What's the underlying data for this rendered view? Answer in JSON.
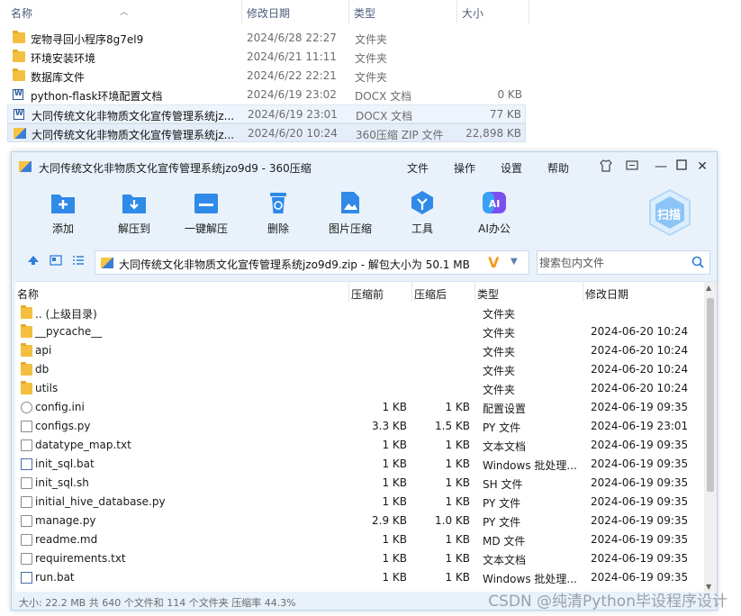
{
  "explorer": {
    "headers": {
      "name": "名称",
      "date": "修改日期",
      "type": "类型",
      "size": "大小"
    },
    "rows": [
      {
        "name": "宠物寻回小程序8g7el9",
        "date": "2024/6/28 22:27",
        "type": "文件夹",
        "size": "",
        "icon": "folder-icon"
      },
      {
        "name": "环境安装环境",
        "date": "2024/6/21 11:11",
        "type": "文件夹",
        "size": "",
        "icon": "folder-icon"
      },
      {
        "name": "数据库文件",
        "date": "2024/6/22 22:21",
        "type": "文件夹",
        "size": "",
        "icon": "folder-icon"
      },
      {
        "name": "python-flask环境配置文档",
        "date": "2024/6/19 23:02",
        "type": "DOCX 文档",
        "size": "0 KB",
        "icon": "docx-icon"
      },
      {
        "name": "大同传统文化非物质文化宣传管理系统jz...",
        "date": "2024/6/19 23:01",
        "type": "DOCX 文档",
        "size": "77 KB",
        "icon": "docx-icon"
      },
      {
        "name": "大同传统文化非物质文化宣传管理系统jz...",
        "date": "2024/6/20 10:24",
        "type": "360压缩 ZIP 文件",
        "size": "22,898 KB",
        "icon": "zip-icon"
      }
    ]
  },
  "window": {
    "title": "大同传统文化非物质文化宣传管理系统jzo9d9 - 360压缩",
    "menu": [
      "文件",
      "操作",
      "设置",
      "帮助"
    ],
    "toolbar": [
      "添加",
      "解压到",
      "一键解压",
      "删除",
      "图片压缩",
      "工具",
      "AI办公"
    ],
    "scan_label": "扫描",
    "path": "大同传统文化非物质文化宣传管理系统jzo9d9.zip - 解包大小为 50.1 MB",
    "search_placeholder": "搜索包内文件",
    "columns": {
      "name": "名称",
      "before": "压缩前",
      "after": "压缩后",
      "type": "类型",
      "date": "修改日期"
    },
    "files": [
      {
        "name": ".. (上级目录)",
        "before": "",
        "after": "",
        "type": "文件夹",
        "date": "",
        "icon": "folder-icon"
      },
      {
        "name": "__pycache__",
        "before": "",
        "after": "",
        "type": "文件夹",
        "date": "2024-06-20 10:24",
        "icon": "folder-icon"
      },
      {
        "name": "api",
        "before": "",
        "after": "",
        "type": "文件夹",
        "date": "2024-06-20 10:24",
        "icon": "folder-icon"
      },
      {
        "name": "db",
        "before": "",
        "after": "",
        "type": "文件夹",
        "date": "2024-06-20 10:24",
        "icon": "folder-icon"
      },
      {
        "name": "utils",
        "before": "",
        "after": "",
        "type": "文件夹",
        "date": "2024-06-20 10:24",
        "icon": "folder-icon"
      },
      {
        "name": "config.ini",
        "before": "1 KB",
        "after": "1 KB",
        "type": "配置设置",
        "date": "2024-06-19 09:35",
        "icon": "gear-file-icon"
      },
      {
        "name": "configs.py",
        "before": "3.3 KB",
        "after": "1.5 KB",
        "type": "PY 文件",
        "date": "2024-06-19 23:01",
        "icon": "file-icon"
      },
      {
        "name": "datatype_map.txt",
        "before": "1 KB",
        "after": "1 KB",
        "type": "文本文档",
        "date": "2024-06-19 09:35",
        "icon": "file-icon"
      },
      {
        "name": "init_sql.bat",
        "before": "1 KB",
        "after": "1 KB",
        "type": "Windows 批处理...",
        "date": "2024-06-19 09:35",
        "icon": "bat-icon"
      },
      {
        "name": "init_sql.sh",
        "before": "1 KB",
        "after": "1 KB",
        "type": "SH 文件",
        "date": "2024-06-19 09:35",
        "icon": "file-icon"
      },
      {
        "name": "initial_hive_database.py",
        "before": "1 KB",
        "after": "1 KB",
        "type": "PY 文件",
        "date": "2024-06-19 09:35",
        "icon": "file-icon"
      },
      {
        "name": "manage.py",
        "before": "2.9 KB",
        "after": "1.0 KB",
        "type": "PY 文件",
        "date": "2024-06-19 09:35",
        "icon": "file-icon"
      },
      {
        "name": "readme.md",
        "before": "1 KB",
        "after": "1 KB",
        "type": "MD 文件",
        "date": "2024-06-19 09:35",
        "icon": "file-icon"
      },
      {
        "name": "requirements.txt",
        "before": "1 KB",
        "after": "1 KB",
        "type": "文本文档",
        "date": "2024-06-19 09:35",
        "icon": "file-icon"
      },
      {
        "name": "run.bat",
        "before": "1 KB",
        "after": "1 KB",
        "type": "Windows 批处理...",
        "date": "2024-06-19 09:35",
        "icon": "bat-icon"
      }
    ],
    "status": "大小: 22.2 MB 共 640 个文件和 114 个文件夹 压缩率 44.3%"
  },
  "watermark": "CSDN @纯清Python毕设程序设计",
  "colors": {
    "accent": "#2f8ae8",
    "window_bg": "#e9f2fb",
    "folder": "#f4bf3f"
  }
}
